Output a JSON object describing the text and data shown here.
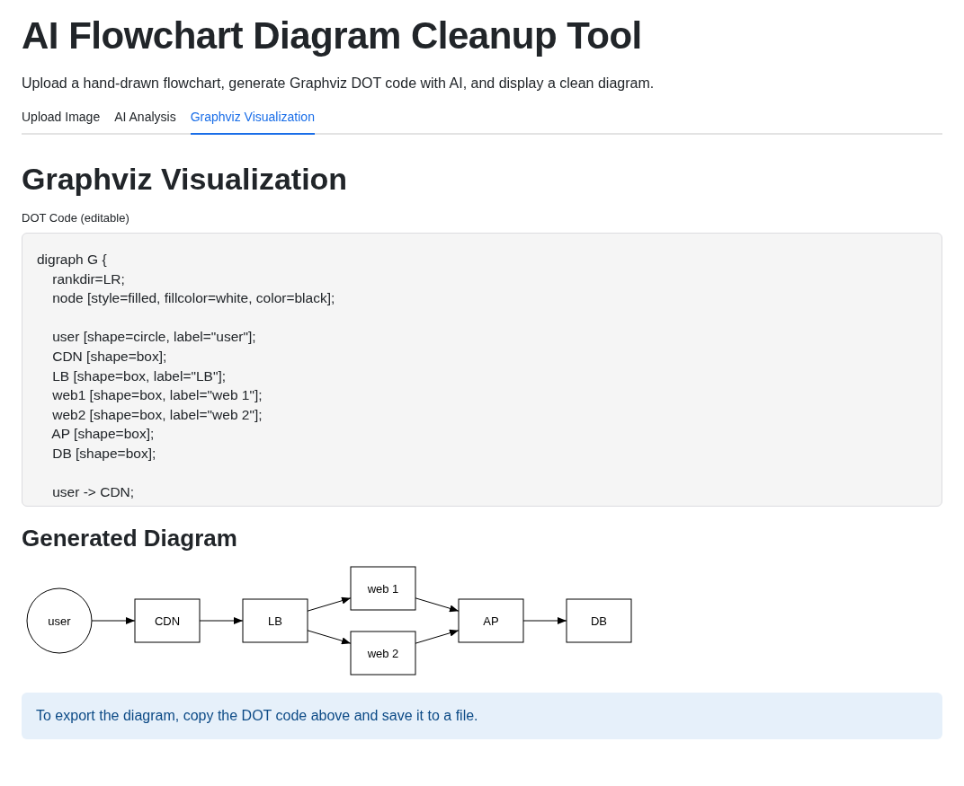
{
  "title": "AI Flowchart Diagram Cleanup Tool",
  "subtitle": "Upload a hand-drawn flowchart, generate Graphviz DOT code with AI, and display a clean diagram.",
  "tabs": [
    {
      "label": "Upload Image",
      "selected": false
    },
    {
      "label": "AI Analysis",
      "selected": false
    },
    {
      "label": "Graphviz Visualization",
      "selected": true
    }
  ],
  "section_title": "Graphviz Visualization",
  "dot_code": {
    "label": "DOT Code (editable)",
    "code": "digraph G {\n    rankdir=LR;\n    node [style=filled, fillcolor=white, color=black];\n\n    user [shape=circle, label=\"user\"];\n    CDN [shape=box];\n    LB [shape=box, label=\"LB\"];\n    web1 [shape=box, label=\"web 1\"];\n    web2 [shape=box, label=\"web 2\"];\n    AP [shape=box];\n    DB [shape=box];\n\n    user -> CDN;"
  },
  "diagram": {
    "title": "Generated Diagram",
    "nodes": [
      {
        "label": "user",
        "kind": "circle"
      },
      {
        "label": "CDN",
        "kind": "box"
      },
      {
        "label": "LB",
        "kind": "box"
      },
      {
        "label": "web 1",
        "kind": "box"
      },
      {
        "label": "web 2",
        "kind": "box"
      },
      {
        "label": "AP",
        "kind": "box"
      },
      {
        "label": "DB",
        "kind": "box"
      }
    ]
  },
  "info": "To export the diagram, copy the DOT code above and save it to a file."
}
